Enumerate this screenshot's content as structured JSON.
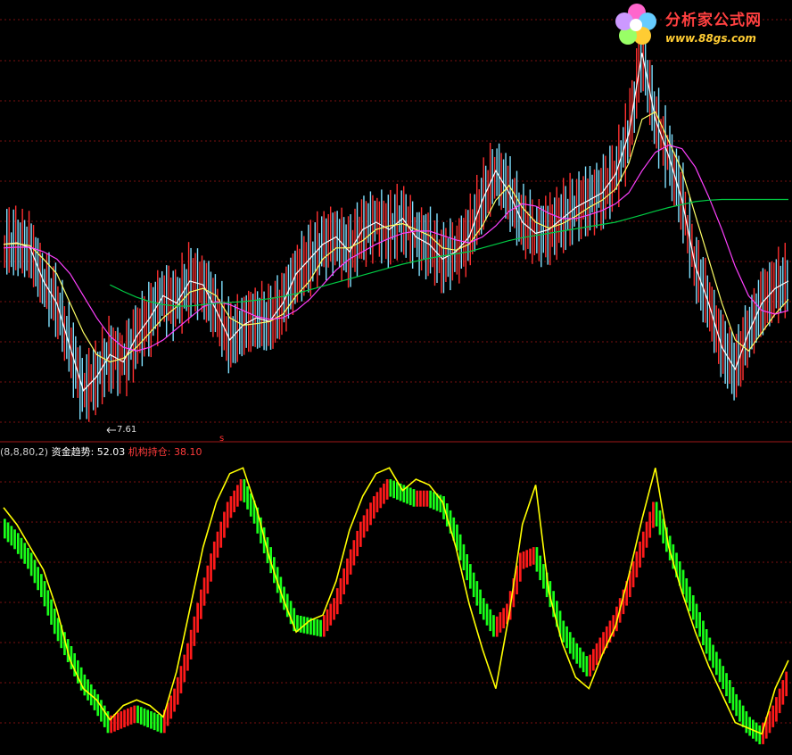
{
  "legend": {
    "params": "(8,8,80,2)",
    "series1_label": "资金趋势:",
    "series1_value": "52.03",
    "series2_label": "机构持仓:",
    "series2_value": "38.10"
  },
  "logo": {
    "title": "分析家公式网",
    "url": "www.88gs.com"
  },
  "low_label": "7.61",
  "colors": {
    "background": "#000000",
    "grid": "#7a1010",
    "divider": "#a01818",
    "candle_up": "#ff3030",
    "candle_down": "#7fe0ff",
    "ma_short": "#ffffff",
    "ma_mid": "#ffff66",
    "ma_long": "#ff40ff",
    "ma_very_long": "#00cc44",
    "bar_up": "#ff1a1a",
    "bar_down": "#19ff19",
    "trend_line": "#ffff00"
  },
  "chart_data": [
    {
      "type": "line",
      "name": "price-panel",
      "x": [
        0,
        1,
        2,
        3,
        4,
        5,
        6,
        7,
        8,
        9,
        10,
        11,
        12,
        13,
        14,
        15,
        16,
        17,
        18,
        19,
        20,
        21,
        22,
        23,
        24,
        25,
        26,
        27,
        28,
        29,
        30,
        31,
        32,
        33,
        34,
        35,
        36,
        37,
        38,
        39,
        40,
        41,
        42,
        43,
        44,
        45,
        46,
        47,
        48,
        49,
        50,
        51,
        52,
        53,
        54,
        55,
        56,
        57,
        58,
        59
      ],
      "series": [
        {
          "values": [
            9.6,
            9.62,
            9.55,
            9.1,
            8.8,
            8.2,
            7.61,
            7.8,
            8.1,
            8.0,
            8.35,
            8.6,
            8.9,
            8.8,
            9.1,
            9.05,
            8.7,
            8.3,
            8.5,
            8.6,
            8.55,
            8.8,
            9.2,
            9.4,
            9.6,
            9.7,
            9.5,
            9.8,
            9.9,
            9.8,
            9.95,
            9.7,
            9.6,
            9.4,
            9.5,
            9.7,
            10.2,
            10.6,
            10.3,
            9.9,
            9.75,
            9.8,
            9.95,
            10.1,
            10.2,
            10.3,
            10.55,
            11.1,
            12.2,
            11.3,
            10.8,
            10.2,
            9.3,
            8.8,
            8.2,
            7.9,
            8.4,
            8.8,
            9.0,
            9.1
          ]
        },
        {
          "values": [
            9.6,
            9.61,
            9.58,
            9.4,
            9.2,
            8.8,
            8.4,
            8.1,
            8.0,
            8.05,
            8.2,
            8.4,
            8.6,
            8.75,
            8.95,
            9.0,
            8.9,
            8.6,
            8.5,
            8.52,
            8.55,
            8.65,
            8.9,
            9.1,
            9.4,
            9.55,
            9.55,
            9.65,
            9.8,
            9.85,
            9.88,
            9.8,
            9.72,
            9.55,
            9.52,
            9.6,
            9.85,
            10.2,
            10.4,
            10.1,
            9.9,
            9.82,
            9.88,
            9.98,
            10.1,
            10.2,
            10.35,
            10.7,
            11.3,
            11.4,
            11.0,
            10.6,
            10.0,
            9.4,
            8.8,
            8.3,
            8.15,
            8.4,
            8.65,
            8.85
          ]
        },
        {
          "values": [
            9.55,
            9.56,
            9.56,
            9.5,
            9.4,
            9.2,
            8.9,
            8.6,
            8.35,
            8.2,
            8.15,
            8.2,
            8.3,
            8.45,
            8.6,
            8.75,
            8.82,
            8.78,
            8.7,
            8.62,
            8.58,
            8.6,
            8.7,
            8.85,
            9.05,
            9.25,
            9.4,
            9.5,
            9.6,
            9.68,
            9.75,
            9.78,
            9.78,
            9.72,
            9.66,
            9.62,
            9.7,
            9.85,
            10.05,
            10.15,
            10.12,
            10.02,
            9.95,
            9.95,
            10.0,
            10.06,
            10.15,
            10.3,
            10.6,
            10.85,
            10.95,
            10.9,
            10.65,
            10.25,
            9.8,
            9.3,
            8.9,
            8.7,
            8.65,
            8.7
          ]
        },
        {
          "values": [
            null,
            null,
            null,
            null,
            null,
            null,
            null,
            null,
            9.05,
            8.96,
            8.88,
            8.82,
            8.78,
            8.76,
            8.76,
            8.78,
            8.8,
            8.81,
            8.82,
            8.84,
            8.86,
            8.89,
            8.93,
            8.98,
            9.03,
            9.08,
            9.13,
            9.18,
            9.23,
            9.28,
            9.33,
            9.37,
            9.41,
            9.44,
            9.47,
            9.5,
            9.55,
            9.6,
            9.65,
            9.69,
            9.72,
            9.75,
            9.78,
            9.81,
            9.84,
            9.87,
            9.9,
            9.95,
            10.0,
            10.05,
            10.1,
            10.14,
            10.18,
            10.2,
            10.21,
            10.21,
            10.21,
            10.21,
            10.21,
            10.21
          ]
        }
      ],
      "ylim": [
        7.0,
        12.8
      ]
    },
    {
      "type": "bar",
      "name": "indicator-panel",
      "x": [
        0,
        1,
        2,
        3,
        4,
        5,
        6,
        7,
        8,
        9,
        10,
        11,
        12,
        13,
        14,
        15,
        16,
        17,
        18,
        19,
        20,
        21,
        22,
        23,
        24,
        25,
        26,
        27,
        28,
        29,
        30,
        31,
        32,
        33,
        34,
        35,
        36,
        37,
        38,
        39,
        40,
        41,
        42,
        43,
        44,
        45,
        46,
        47,
        48,
        49,
        50,
        51,
        52,
        53,
        54,
        55,
        56,
        57,
        58,
        59
      ],
      "series": [
        {
          "values": [
            80,
            75,
            68,
            58,
            45,
            35,
            25,
            18,
            10,
            12,
            14,
            12,
            10,
            20,
            36,
            55,
            72,
            86,
            94,
            84,
            70,
            56,
            46,
            45,
            44,
            52,
            66,
            79,
            88,
            94,
            92,
            90,
            90,
            88,
            78,
            64,
            52,
            44,
            50,
            68,
            70,
            58,
            44,
            36,
            30,
            38,
            46,
            58,
            72,
            86,
            74,
            62,
            50,
            38,
            28,
            18,
            10,
            6,
            14,
            26
          ]
        },
        {
          "values": [
            84,
            78,
            70,
            62,
            48,
            30,
            20,
            16,
            9,
            14,
            16,
            14,
            10,
            26,
            48,
            70,
            86,
            96,
            98,
            84,
            66,
            52,
            40,
            44,
            46,
            58,
            76,
            88,
            96,
            98,
            90,
            94,
            92,
            86,
            70,
            50,
            34,
            20,
            46,
            78,
            92,
            54,
            36,
            24,
            20,
            32,
            42,
            60,
            80,
            98,
            70,
            54,
            40,
            28,
            18,
            8,
            6,
            4,
            20,
            30
          ]
        }
      ],
      "ylim": [
        0,
        100
      ]
    }
  ]
}
